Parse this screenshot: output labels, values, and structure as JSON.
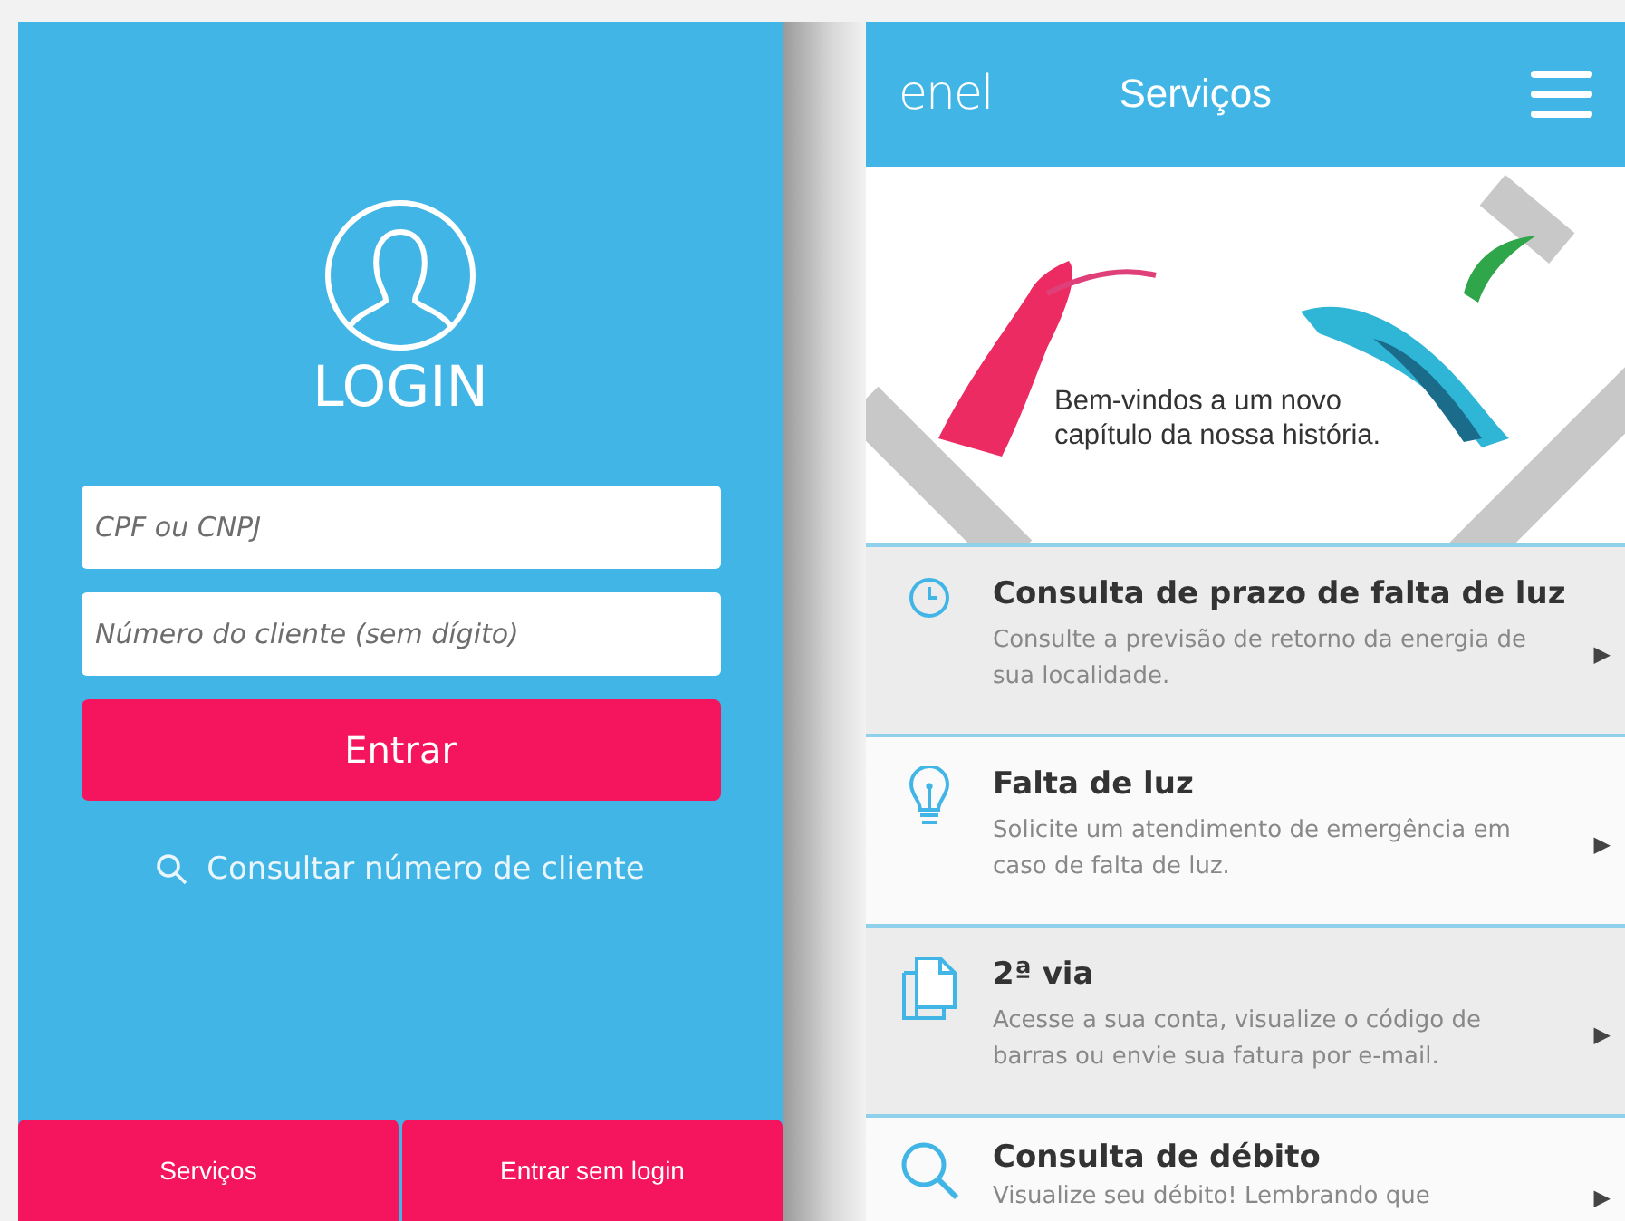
{
  "login_screen": {
    "title": "LOGIN",
    "fields": [
      {
        "placeholder": "CPF ou CNPJ"
      },
      {
        "placeholder": "Número do cliente (sem dígito)"
      }
    ],
    "submit_button": "Entrar",
    "lookup_link": "Consultar número de cliente",
    "bottom_buttons": [
      "Serviços",
      "Entrar sem login"
    ]
  },
  "services_screen": {
    "logo": "enel",
    "title": "Serviços",
    "banner_text": "Bem-vindos a um novo capítulo da nossa história.",
    "items": [
      {
        "kind": "clock",
        "title": "Consulta de prazo de falta de luz",
        "description": "Consulte a previsão de retorno da energia de sua localidade.",
        "arrow": "▶"
      },
      {
        "kind": "bulb",
        "title": "Falta de luz",
        "description": "Solicite um atendimento de emergência em caso de falta de luz.",
        "arrow": "▶"
      },
      {
        "kind": "document",
        "title": "2ª via",
        "description": "Acesse a sua conta, visualize o código de barras ou envie sua fatura por e-mail.",
        "arrow": "▶"
      },
      {
        "kind": "search",
        "title": "Consulta de débito",
        "description": "Visualize seu débito! Lembrando que",
        "arrow": "▶"
      }
    ]
  }
}
